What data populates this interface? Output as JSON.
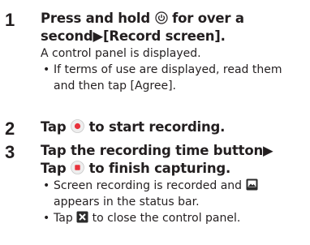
{
  "steps": [
    {
      "number": "1",
      "heading_line1_a": "Press and hold",
      "heading_line1_b": "for over a",
      "heading_line2": "second▶[Record screen].",
      "description": "A control panel is displayed.",
      "bullet_line1": "If terms of use are displayed, read them",
      "bullet_line2": "and then tap [Agree]."
    },
    {
      "number": "2",
      "heading_a": "Tap",
      "heading_b": "to start recording."
    },
    {
      "number": "3",
      "heading_line1": "Tap the recording time button▶",
      "heading_line2_a": "Tap",
      "heading_line2_b": "to finish capturing.",
      "bullet1_line1_a": "Screen recording is recorded and",
      "bullet1_line2": "appears in the status bar.",
      "bullet2_a": "Tap",
      "bullet2_b": "to close the control panel."
    }
  ],
  "icons": {
    "power": "power-key-icon",
    "record": "record-button-icon",
    "stop": "stop-button-icon",
    "status": "screen-recording-status-icon",
    "close": "close-panel-icon"
  },
  "colors": {
    "text": "#231f20",
    "record_red": "#e8323c",
    "icon_dark": "#2b2b2b"
  }
}
